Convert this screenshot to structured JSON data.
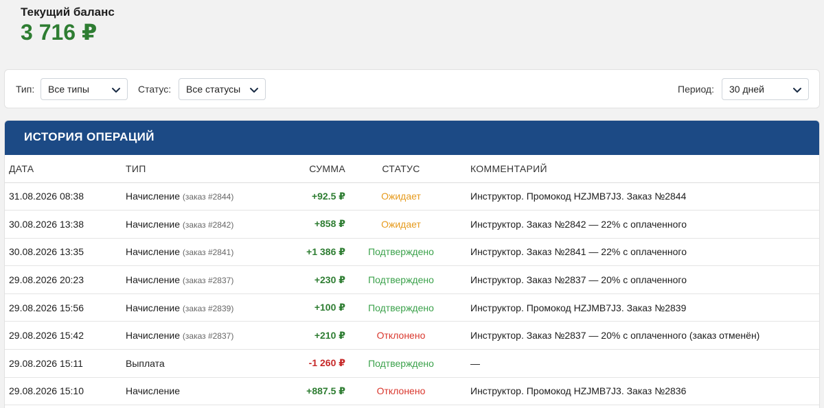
{
  "balance": {
    "label": "Текущий баланс",
    "value": "3 716 ₽",
    "color": "#2e7d32"
  },
  "filters": {
    "type_label": "Тип:",
    "type_value": "Все типы",
    "status_label": "Статус:",
    "status_value": "Все статусы",
    "period_label": "Период:",
    "period_value": "30 дней"
  },
  "history": {
    "title": "ИСТОРИЯ ОПЕРАЦИЙ",
    "header_color": "#1c4a85",
    "columns": [
      "ДАТА",
      "ТИП",
      "СУММА",
      "СТАТУС",
      "КОММЕНТАРИЙ"
    ],
    "rows": [
      {
        "date": "31.08.2026 08:38",
        "type": "Начисление",
        "order": "(заказ #2844)",
        "amount": "+92.5 ₽",
        "sign": "pos",
        "status": "Ожидает",
        "status_kind": "pending",
        "comment": "Инструктор. Промокод HZJMB7J3. Заказ №2844"
      },
      {
        "date": "30.08.2026 13:38",
        "type": "Начисление",
        "order": "(заказ #2842)",
        "amount": "+858 ₽",
        "sign": "pos",
        "status": "Ожидает",
        "status_kind": "pending",
        "comment": "Инструктор. Заказ №2842 — 22% с оплаченного"
      },
      {
        "date": "30.08.2026 13:35",
        "type": "Начисление",
        "order": "(заказ #2841)",
        "amount": "+1 386 ₽",
        "sign": "pos",
        "status": "Подтверждено",
        "status_kind": "ok",
        "comment": "Инструктор. Заказ №2841 — 22% с оплаченного"
      },
      {
        "date": "29.08.2026 20:23",
        "type": "Начисление",
        "order": "(заказ #2837)",
        "amount": "+230 ₽",
        "sign": "pos",
        "status": "Подтверждено",
        "status_kind": "ok",
        "comment": "Инструктор. Заказ №2837 — 20% с оплаченного"
      },
      {
        "date": "29.08.2026 15:56",
        "type": "Начисление",
        "order": "(заказ #2839)",
        "amount": "+100 ₽",
        "sign": "pos",
        "status": "Подтверждено",
        "status_kind": "ok",
        "comment": "Инструктор. Промокод HZJMB7J3. Заказ №2839"
      },
      {
        "date": "29.08.2026 15:42",
        "type": "Начисление",
        "order": "(заказ #2837)",
        "amount": "+210 ₽",
        "sign": "pos",
        "status": "Отклонено",
        "status_kind": "rejected",
        "comment": "Инструктор. Заказ №2837 — 20% с оплаченного (заказ отменён)"
      },
      {
        "date": "29.08.2026 15:11",
        "type": "Выплата",
        "order": "",
        "amount": "-1 260 ₽",
        "sign": "neg",
        "status": "Подтверждено",
        "status_kind": "ok",
        "comment": "—"
      },
      {
        "date": "29.08.2026 15:10",
        "type": "Начисление",
        "order": "",
        "amount": "+887.5 ₽",
        "sign": "pos",
        "status": "Отклонено",
        "status_kind": "rejected",
        "comment": "Инструктор. Промокод HZJMB7J3. Заказ №2836"
      }
    ]
  },
  "icons": {
    "select_chevron": "chevron-down-icon"
  }
}
